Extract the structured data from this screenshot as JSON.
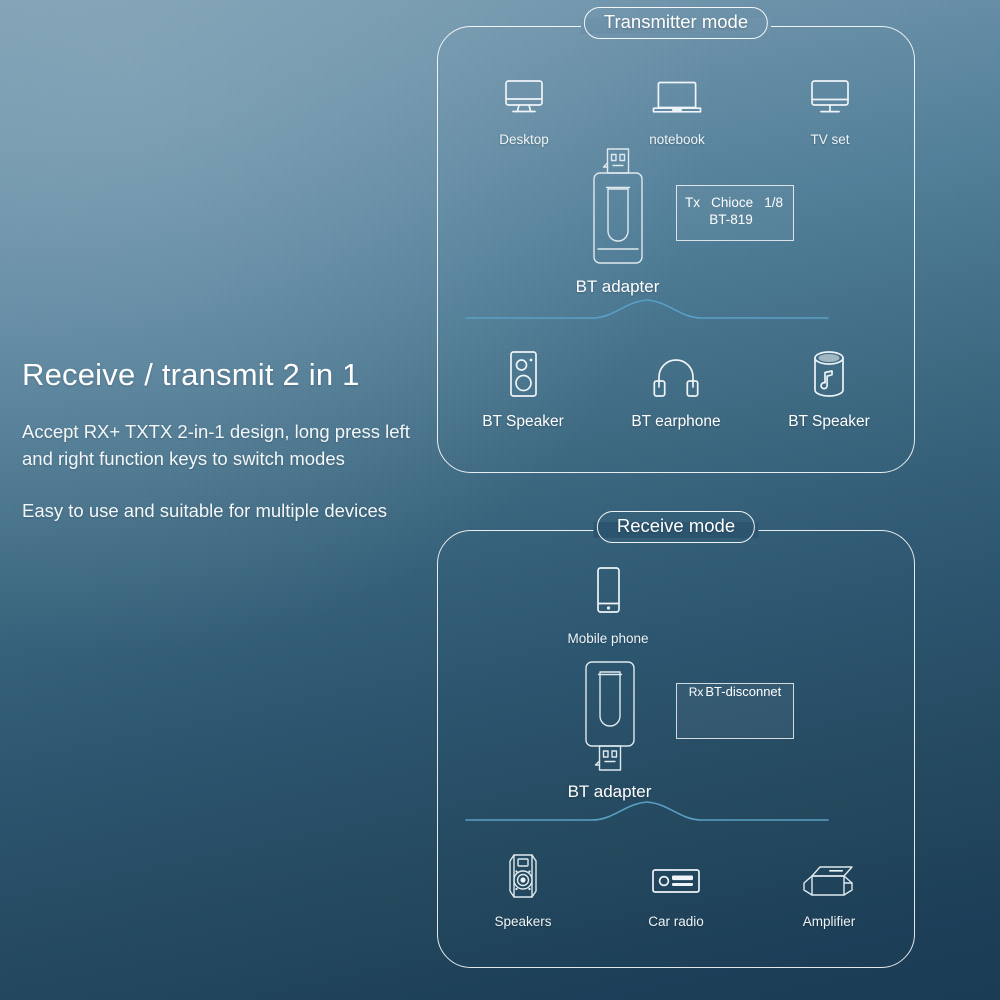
{
  "background": {
    "gradient_from": "#7d9fb3",
    "gradient_to": "#1a3b53",
    "accent_line": "#5a9fc4"
  },
  "copy": {
    "headline": "Receive / transmit 2 in 1",
    "paragraph_1": "Accept RX+ TXTX 2-in-1 design, long press left and right function keys to switch modes",
    "paragraph_2": "Easy to use and suitable for multiple devices"
  },
  "transmitter": {
    "title": "Transmitter mode",
    "sources": [
      {
        "label": "Desktop",
        "icon": "desktop-monitor-icon"
      },
      {
        "label": "notebook",
        "icon": "laptop-icon"
      },
      {
        "label": "TV set",
        "icon": "tv-icon"
      }
    ],
    "adapter": {
      "label": "BT adapter",
      "icon": "usb-bluetooth-adapter-icon"
    },
    "screen": {
      "mode": "Tx",
      "status": "Chioce",
      "count": "1/8",
      "device": "BT-819"
    },
    "outputs": [
      {
        "label": "BT Speaker",
        "icon": "bookshelf-speaker-icon"
      },
      {
        "label": "BT earphone",
        "icon": "headphones-icon"
      },
      {
        "label": "BT Speaker",
        "icon": "cylinder-speaker-icon"
      }
    ]
  },
  "receive": {
    "title": "Receive mode",
    "sources": [
      {
        "label": "Mobile phone",
        "icon": "smartphone-icon"
      }
    ],
    "adapter": {
      "label": "BT adapter",
      "icon": "usb-bluetooth-adapter-flipped-icon"
    },
    "screen": {
      "mode": "Rx",
      "status": "BT-disconnet"
    },
    "outputs": [
      {
        "label": "Speakers",
        "icon": "studio-monitor-icon"
      },
      {
        "label": "Car radio",
        "icon": "car-stereo-icon"
      },
      {
        "label": "Amplifier",
        "icon": "amplifier-box-icon"
      }
    ]
  }
}
